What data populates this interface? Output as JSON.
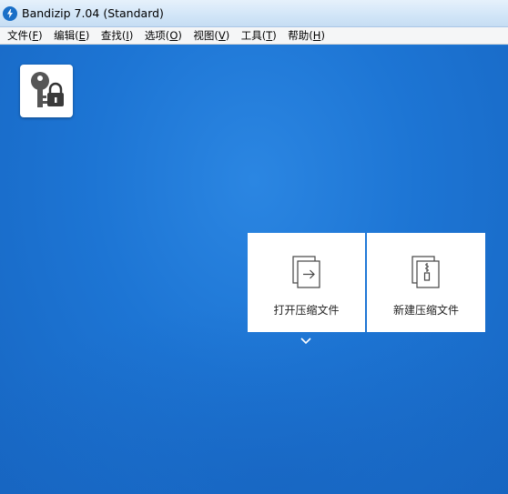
{
  "window": {
    "title": "Bandizip 7.04 (Standard)",
    "app_icon": "bandizip-logo-icon"
  },
  "menubar": {
    "items": [
      {
        "label": "文件(",
        "key": "F",
        "tail": ")"
      },
      {
        "label": "编辑(",
        "key": "E",
        "tail": ")"
      },
      {
        "label": "查找(",
        "key": "I",
        "tail": ")"
      },
      {
        "label": "选项(",
        "key": "O",
        "tail": ")"
      },
      {
        "label": "视图(",
        "key": "V",
        "tail": ")"
      },
      {
        "label": "工具(",
        "key": "T",
        "tail": ")"
      },
      {
        "label": "帮助(",
        "key": "H",
        "tail": ")"
      }
    ]
  },
  "workspace": {
    "key_tile_icon": "key-lock-icon",
    "open_archive": {
      "label": "打开压缩文件",
      "icon": "open-archive-icon"
    },
    "new_archive": {
      "label": "新建压缩文件",
      "icon": "new-archive-icon"
    },
    "expand_icon": "chevron-down-icon"
  },
  "colors": {
    "background": "#1f79d6",
    "card": "#ffffff",
    "titlebar": "#d3e6f8"
  }
}
